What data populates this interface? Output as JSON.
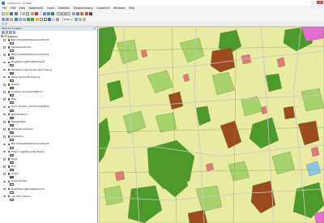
{
  "window": {
    "title": "ALKIS.mxd - ArcMap",
    "buttons": [
      "–",
      "□",
      "✕"
    ]
  },
  "menu": [
    "File",
    "Edit",
    "View",
    "Bookmarks",
    "Insert",
    "Selection",
    "Geoprocessing",
    "Customize",
    "Windows",
    "Help"
  ],
  "toolbar": {
    "scale": "1:46.050",
    "editor_label": "Editor ▾"
  },
  "toc": {
    "title": "Table Of Contents",
    "close_glyph": "✕",
    "root_label": "Layers",
    "layers": [
      {
        "name": "NaturUmweltOderBodenschutzrecht",
        "swatch": "#ffffff"
      },
      {
        "name": "Gewässermerkmal",
        "swatch": "#ffffff"
      },
      {
        "name": "NaturUmweltOderBodenschutzrecht",
        "swatch": "#ffffff"
      },
      {
        "name": "KlassifizierungNachWasserrecht",
        "swatch": "#ffffff"
      },
      {
        "name": "Flächebesondererfunktionaler Prägung",
        "swatch": "#e46fd0"
      },
      {
        "name": "Fläche gemischter Nutzung",
        "swatch": "#f2d3b0"
      },
      {
        "name": "Friedhof",
        "swatch": "#8fb34d"
      },
      {
        "name": "Industrie- und Gewerbefläche",
        "swatch": "#b9b9c6"
      },
      {
        "name": "Platz",
        "swatch": "#d0d0d0"
      },
      {
        "name": "Sport-, Freizeit- und Erholungsfläche",
        "swatch": "#a5d67c"
      },
      {
        "name": "Wohnbaufläche",
        "swatch": "#e88080"
      },
      {
        "name": "Fließgewässer",
        "swatch": "#8fc3ef"
      },
      {
        "name": "Stehendes Gewässer",
        "swatch": "#8fc3ef"
      },
      {
        "name": "Schutzzone",
        "swatch": "#ffffff"
      },
      {
        "name": "NaturUmweltOderBodenschutzrecht",
        "swatch": "#ffffff"
      },
      {
        "name": "Unland; Vegetationslose Fläche",
        "swatch": "#ded9c8"
      },
      {
        "name": "Heide",
        "swatch": "#d8c48e"
      },
      {
        "name": "Moor",
        "swatch": "#a8a2d4"
      },
      {
        "name": "Sumpf",
        "swatch": "#6e8f4c"
      },
      {
        "name": "Landwirtschaft",
        "swatch": "#e9ee9d"
      },
      {
        "name": "KlassifizierungNachWasserrecht",
        "swatch": "#ffffff"
      },
      {
        "name": "<all other values>",
        "swatch": "#ffffff"
      }
    ]
  },
  "map": {
    "colors": {
      "agriculture": "#e8eba2",
      "forest": "#4d9a2c",
      "grassland": "#a7d36e",
      "heath": "#9c4b1e",
      "settlement": "#e27878",
      "special": "#e46fd0",
      "water": "#8fc3ef",
      "road": "#c8c8c8"
    }
  }
}
